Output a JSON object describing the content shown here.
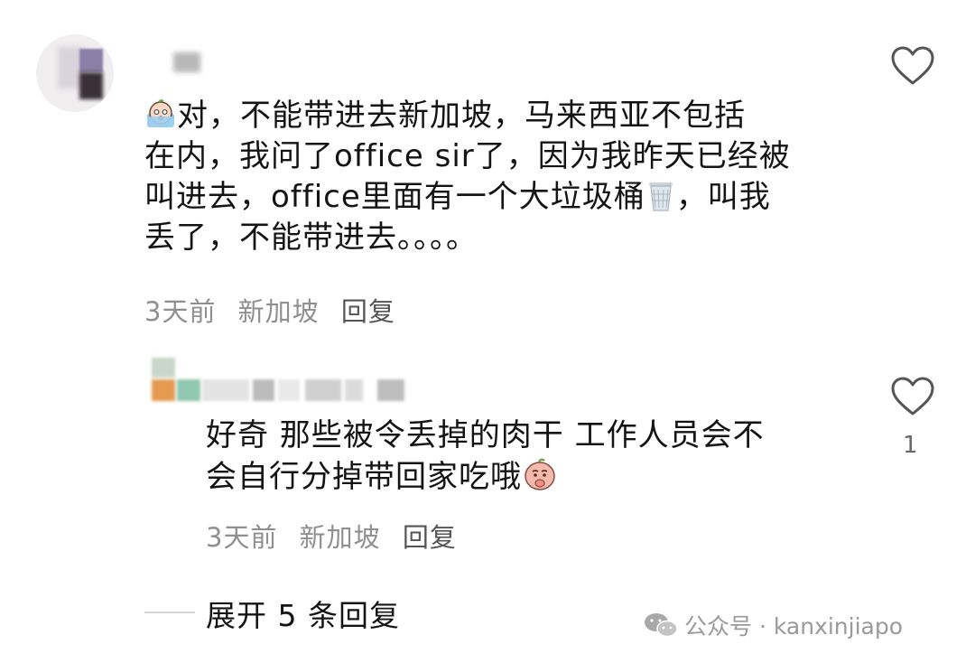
{
  "comment1": {
    "lines": [
      "对，不能带进去新加坡，马来西亚不包括",
      "在内，我问了office sir了，因为我昨天已经被",
      "叫进去，office里面有一个大垃圾桶",
      "，叫我",
      "丢了，不能带进去。。。。"
    ],
    "time": "3天前",
    "location": "新加坡",
    "reply_label": "回复",
    "emojis": [
      "crying-face-icon",
      "trash-can-icon"
    ]
  },
  "comment2": {
    "lines": [
      "好奇 那些被令丢掉的肉干 工作人员会不",
      "会自行分掉带回家吃哦"
    ],
    "time": "3天前",
    "location": "新加坡",
    "reply_label": "回复",
    "likes": "1",
    "emojis": [
      "thinking-face-icon"
    ]
  },
  "expand_replies": "展开 5 条回复",
  "watermark": "公众号 · kanxinjiapo",
  "colors": {
    "text": "#141414",
    "meta": "#8f8f8f",
    "heart": "#555555"
  }
}
